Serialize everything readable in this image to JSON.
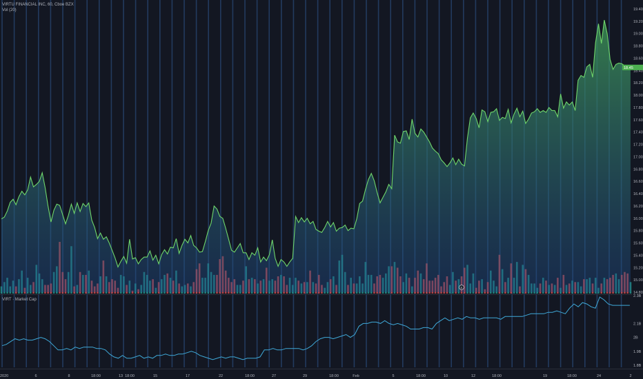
{
  "legend": {
    "main": "VIRTU FINANCIAL INC, 60, Cboe BZX",
    "volume": "Vol (20)",
    "sub": "VIRT · Market Cap"
  },
  "colors": {
    "background": "#131722",
    "grid_vertical": "#2a4a78",
    "price_line": "#6fd66b",
    "area_top": "#3f9a57",
    "area_bottom": "#1f4a8a",
    "volume_up": "#26a69a",
    "volume_down": "#ef5350",
    "market_cap_line": "#3fa9d8",
    "last_price_tag": "#4caf50"
  },
  "chart_data": [
    {
      "type": "area",
      "title": "VIRTU FINANCIAL INC, 60, Cboe BZX",
      "y_ticks": [
        "19.40",
        "19.20",
        "19.00",
        "18.80",
        "18.60",
        "18.40",
        "18.20",
        "18.00",
        "17.80",
        "17.60",
        "17.40",
        "17.20",
        "17.00",
        "16.80",
        "16.60",
        "16.40",
        "16.20",
        "16.00",
        "15.80",
        "15.60",
        "15.40",
        "15.20",
        "15.00",
        "14.80"
      ],
      "ylim": [
        14.8,
        19.4
      ],
      "x_ticks": [
        "2020",
        "6",
        "8",
        "18:00",
        "13",
        "18:00",
        "15",
        "17",
        "22",
        "18:00",
        "27",
        "29",
        "18:00",
        "Feb",
        "5",
        "18:00",
        "10",
        "12",
        "18:00",
        "19",
        "18:00",
        "24",
        "2"
      ],
      "last_price": "18.45",
      "series": [
        {
          "values": [
            15.99,
            16.02,
            16.12,
            16.26,
            16.31,
            16.22,
            16.35,
            16.44,
            16.38,
            16.46,
            16.67,
            16.51,
            16.55,
            16.6,
            16.74,
            16.5,
            16.2,
            15.94,
            16.13,
            16.23,
            16.21,
            16.06,
            15.91,
            16.05,
            16.23,
            16.08,
            16.25,
            16.11,
            16.24,
            16.19,
            16.25,
            15.97,
            15.85,
            15.67,
            15.76,
            15.66,
            15.7,
            15.6,
            15.48,
            15.36,
            15.21,
            15.3,
            15.38,
            15.27,
            15.66,
            15.34,
            15.36,
            15.26,
            15.33,
            15.37,
            15.37,
            15.47,
            15.32,
            15.4,
            15.26,
            15.41,
            15.49,
            15.42,
            15.53,
            15.52,
            15.67,
            15.43,
            15.56,
            15.66,
            15.6,
            15.72,
            15.56,
            15.52,
            15.45,
            15.46,
            15.62,
            15.8,
            15.92,
            16.2,
            16.15,
            16.03,
            16.0,
            15.84,
            15.66,
            15.48,
            15.45,
            15.52,
            15.59,
            15.44,
            15.44,
            15.33,
            15.44,
            15.4,
            15.52,
            15.29,
            15.37,
            15.31,
            15.41,
            15.65,
            15.35,
            15.22,
            15.33,
            15.29,
            15.22,
            15.29,
            15.35,
            16.03,
            15.93,
            16.01,
            15.94,
            16.0,
            15.91,
            15.95,
            15.82,
            15.79,
            15.77,
            15.85,
            15.95,
            15.86,
            15.93,
            15.79,
            15.84,
            15.85,
            15.89,
            15.8,
            15.84,
            15.83,
            15.99,
            16.24,
            16.28,
            16.47,
            16.63,
            16.73,
            16.61,
            16.42,
            16.25,
            16.34,
            16.43,
            16.55,
            16.48,
            17.35,
            17.24,
            17.22,
            17.41,
            17.42,
            17.28,
            17.61,
            17.38,
            17.32,
            17.45,
            17.4,
            17.32,
            17.24,
            17.14,
            17.09,
            17.05,
            16.95,
            16.9,
            16.84,
            16.9,
            16.98,
            16.87,
            16.96,
            16.88,
            16.85,
            17.3,
            17.63,
            17.71,
            17.62,
            17.47,
            17.76,
            17.73,
            17.57,
            17.72,
            17.73,
            17.78,
            17.59,
            17.64,
            17.62,
            17.77,
            17.55,
            17.69,
            17.79,
            17.65,
            17.74,
            17.54,
            17.61,
            17.71,
            17.73,
            17.78,
            17.72,
            17.75,
            17.72,
            17.8,
            17.75,
            17.75,
            17.65,
            18.02,
            17.79,
            17.89,
            17.84,
            17.89,
            17.75,
            18.24,
            18.32,
            18.29,
            18.46,
            18.5,
            18.29,
            18.85,
            19.16,
            18.84,
            19.22,
            19.0,
            18.58,
            18.42,
            18.5,
            18.52,
            18.51,
            18.48,
            18.45,
            18.46
          ]
        }
      ]
    },
    {
      "type": "bar",
      "title": "Vol (20)",
      "series": [
        {
          "name": "Vol (20)",
          "values": [
            5,
            8,
            11,
            5,
            9,
            5,
            10,
            16,
            4,
            11,
            6,
            8,
            20,
            14,
            10,
            6,
            6,
            7,
            15,
            19,
            36,
            15,
            10,
            15,
            33,
            5,
            6,
            15,
            13,
            13,
            16,
            9,
            5,
            7,
            12,
            23,
            12,
            8,
            10,
            9,
            4,
            13,
            12,
            6,
            9,
            2,
            7,
            3,
            6,
            15,
            13,
            9,
            10,
            4,
            8,
            10,
            13,
            14,
            11,
            9,
            16,
            7,
            5,
            6,
            7,
            5,
            8,
            17,
            21,
            11,
            11,
            21,
            15,
            13,
            13,
            24,
            26,
            16,
            11,
            8,
            10,
            6,
            6,
            9,
            19,
            10,
            11,
            10,
            7,
            9,
            10,
            18,
            9,
            10,
            9,
            12,
            13,
            12,
            6,
            11,
            6,
            11,
            9,
            7,
            8,
            8,
            16,
            8,
            7,
            13,
            6,
            4,
            8,
            10,
            12,
            6,
            23,
            27,
            15,
            6,
            11,
            7,
            7,
            12,
            7,
            22,
            13,
            13,
            7,
            12,
            13,
            11,
            14,
            19,
            19,
            22,
            18,
            12,
            8,
            14,
            11,
            5,
            11,
            16,
            14,
            10,
            21,
            9,
            9,
            11,
            13,
            5,
            8,
            12,
            6,
            15,
            9,
            10,
            12,
            18,
            20,
            7,
            14,
            4,
            9,
            10,
            3,
            8,
            16,
            9,
            5,
            27,
            17,
            8,
            11,
            21,
            11,
            22,
            5,
            20,
            17,
            13,
            7,
            7,
            4,
            7,
            11,
            9,
            6,
            7,
            6,
            11,
            4,
            13,
            6,
            7,
            9,
            8,
            8,
            5,
            10,
            10,
            11,
            7,
            11,
            4,
            7,
            11,
            10,
            11,
            13,
            14,
            10,
            13,
            15,
            14,
            8,
            16,
            10,
            8,
            13,
            8,
            10,
            10,
            14,
            14
          ]
        }
      ]
    },
    {
      "type": "line",
      "title": "VIRT · Market Cap",
      "y_ticks": [
        "2.3B",
        "2.1B",
        "2B",
        "1.9B",
        "1.8B"
      ],
      "ylim": [
        1.785,
        2.3
      ],
      "series": [
        {
          "values": [
            1.94,
            1.95,
            1.97,
            1.99,
            1.98,
            1.99,
            1.98,
            1.98,
            1.99,
            2.0,
            1.99,
            1.97,
            1.94,
            1.91,
            1.91,
            1.92,
            1.91,
            1.93,
            1.92,
            1.93,
            1.93,
            1.93,
            1.92,
            1.92,
            1.91,
            1.88,
            1.86,
            1.85,
            1.87,
            1.85,
            1.85,
            1.86,
            1.87,
            1.85,
            1.86,
            1.85,
            1.87,
            1.87,
            1.88,
            1.87,
            1.87,
            1.88,
            1.88,
            1.89,
            1.9,
            1.89,
            1.87,
            1.86,
            1.85,
            1.84,
            1.85,
            1.86,
            1.85,
            1.86,
            1.86,
            1.85,
            1.84,
            1.85,
            1.85,
            1.85,
            1.86,
            1.91,
            1.91,
            1.92,
            1.91,
            1.91,
            1.92,
            1.92,
            1.92,
            1.92,
            1.91,
            1.92,
            1.94,
            1.97,
            1.99,
            2.0,
            2.0,
            1.99,
            2.0,
            2.01,
            2.02,
            2.0,
            2.02,
            2.08,
            2.1,
            2.1,
            2.11,
            2.11,
            2.1,
            2.12,
            2.1,
            2.09,
            2.1,
            2.09,
            2.08,
            2.06,
            2.06,
            2.06,
            2.07,
            2.07,
            2.06,
            2.1,
            2.12,
            2.14,
            2.12,
            2.13,
            2.14,
            2.13,
            2.15,
            2.14,
            2.14,
            2.13,
            2.14,
            2.14,
            2.14,
            2.14,
            2.13,
            2.15,
            2.15,
            2.15,
            2.15,
            2.15,
            2.16,
            2.17,
            2.17,
            2.17,
            2.17,
            2.18,
            2.18,
            2.19,
            2.18,
            2.17,
            2.21,
            2.24,
            2.22,
            2.25,
            2.24,
            2.22,
            2.21,
            2.29,
            2.27,
            2.24,
            2.23,
            2.23,
            2.23,
            2.23,
            2.23
          ]
        }
      ]
    }
  ]
}
